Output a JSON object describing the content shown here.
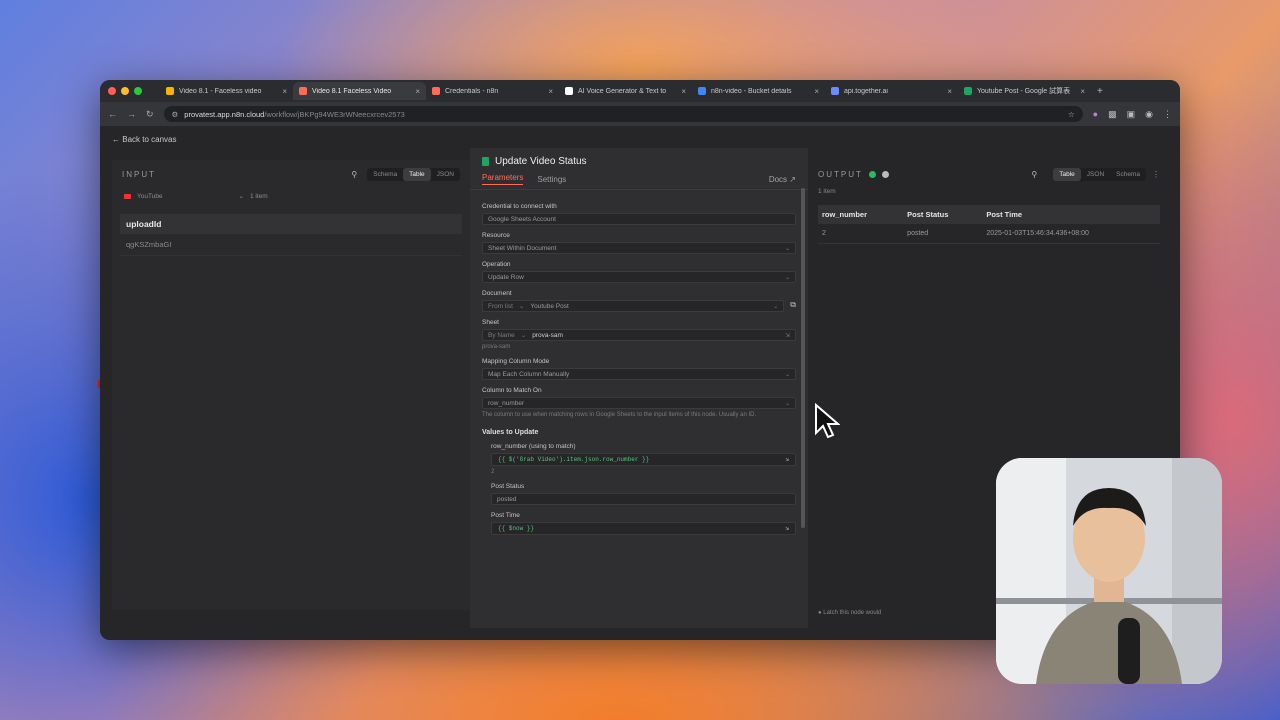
{
  "browser": {
    "tabs": [
      {
        "label": "Video 8.1 - Faceless video",
        "color": "#f4b400",
        "active": false
      },
      {
        "label": "Video 8.1 Faceless Video",
        "color": "#ff6d5a",
        "active": true
      },
      {
        "label": "Credentials - n8n",
        "color": "#ff6d5a",
        "active": false
      },
      {
        "label": "AI Voice Generator & Text to",
        "color": "#ffffff",
        "active": false
      },
      {
        "label": "n8n-video - Bucket details",
        "color": "#4285f4",
        "active": false
      },
      {
        "label": "api.together.ai",
        "color": "#6b8cff",
        "active": false
      },
      {
        "label": "Youtube Post - Google 試算表",
        "color": "#1fa463",
        "active": false
      }
    ],
    "new_tab_label": "+",
    "url_host": "provatest.app.n8n.cloud",
    "url_path": "/workflow/jBKPg94WE3rWNeecxrcev2573"
  },
  "app": {
    "back_label": "Back to canvas",
    "input": {
      "title": "INPUT",
      "view_tabs": [
        "Schema",
        "Table",
        "JSON"
      ],
      "active_view": "Table",
      "source_node": "YouTube",
      "item_count": "1 item",
      "column": "uploadId",
      "value": "qgKSZmbaGI"
    },
    "node": {
      "title": "Update Video Status",
      "tabs": [
        "Parameters",
        "Settings"
      ],
      "docs_label": "Docs",
      "params": {
        "credential_label": "Credential to connect with",
        "credential_value": "Google Sheets Account",
        "resource_label": "Resource",
        "resource_value": "Sheet Within Document",
        "operation_label": "Operation",
        "operation_value": "Update Row",
        "document_label": "Document",
        "document_mode": "From list",
        "document_value": "Youtube Post",
        "sheet_label": "Sheet",
        "sheet_mode": "By Name",
        "sheet_value": "prova-sam",
        "sheet_hint": "prova-sam",
        "mapping_label": "Mapping Column Mode",
        "mapping_value": "Map Each Column Manually",
        "match_label": "Column to Match On",
        "match_value": "row_number",
        "match_hint": "The column to use when matching rows in Google Sheets to the input items of this node. Usually an ID.",
        "values_section": "Values to Update",
        "row_number_label": "row_number (using to match)",
        "row_number_expr": "{{ $('Grab Video').item.json.row_number }}",
        "row_number_result": "2",
        "post_status_label": "Post Status",
        "post_status_value": "posted",
        "post_time_label": "Post Time",
        "post_time_expr": "{{ $now }}"
      }
    },
    "output": {
      "title": "OUTPUT",
      "view_tabs": [
        "Table",
        "JSON",
        "Schema"
      ],
      "active_view": "Table",
      "item_count": "1 item",
      "columns": [
        "row_number",
        "Post Status",
        "Post Time"
      ],
      "rows": [
        [
          "2",
          "posted",
          "2025-01-03T15:46:34.436+08:00"
        ]
      ],
      "footer": "Latch this node would"
    }
  },
  "colors": {
    "accent": "#ff6d5a",
    "success": "#2fb864",
    "sheets": "#1fa463"
  }
}
